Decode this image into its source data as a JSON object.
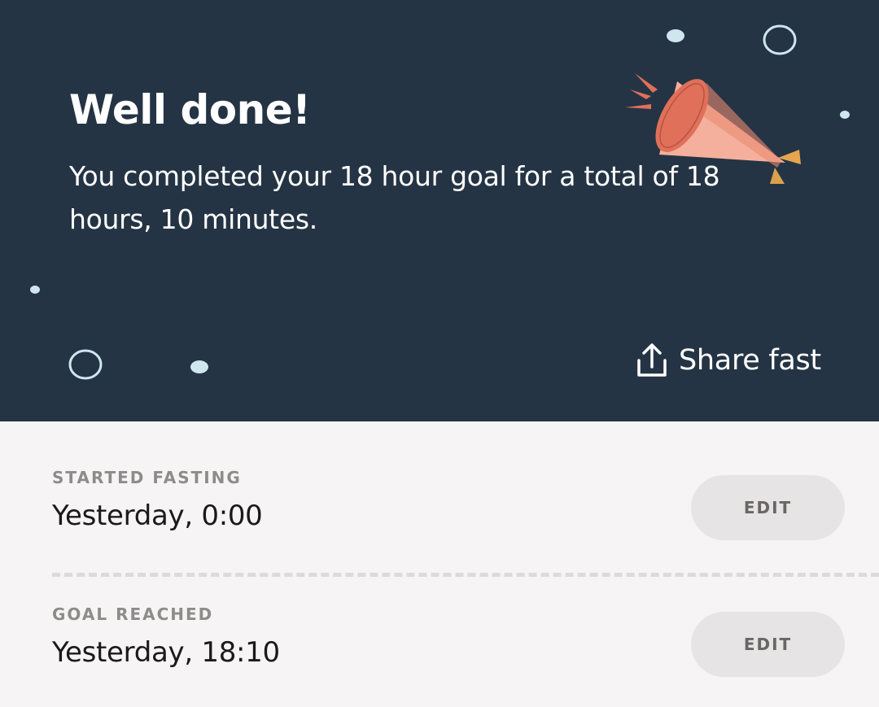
{
  "hero": {
    "title": "Well done!",
    "message": "You completed your 18 hour goal for a total of 18 hours, 10 minutes.",
    "background_color": "#253444",
    "share_label": "Share fast",
    "share_icon": "share-upload-icon",
    "illustration": "party-popper-icon"
  },
  "fasting_log": {
    "started": {
      "label": "STARTED FASTING",
      "value": "Yesterday, 0:00",
      "edit_label": "EDIT"
    },
    "goal": {
      "label": "GOAL REACHED",
      "value": "Yesterday, 18:10",
      "edit_label": "EDIT"
    }
  }
}
